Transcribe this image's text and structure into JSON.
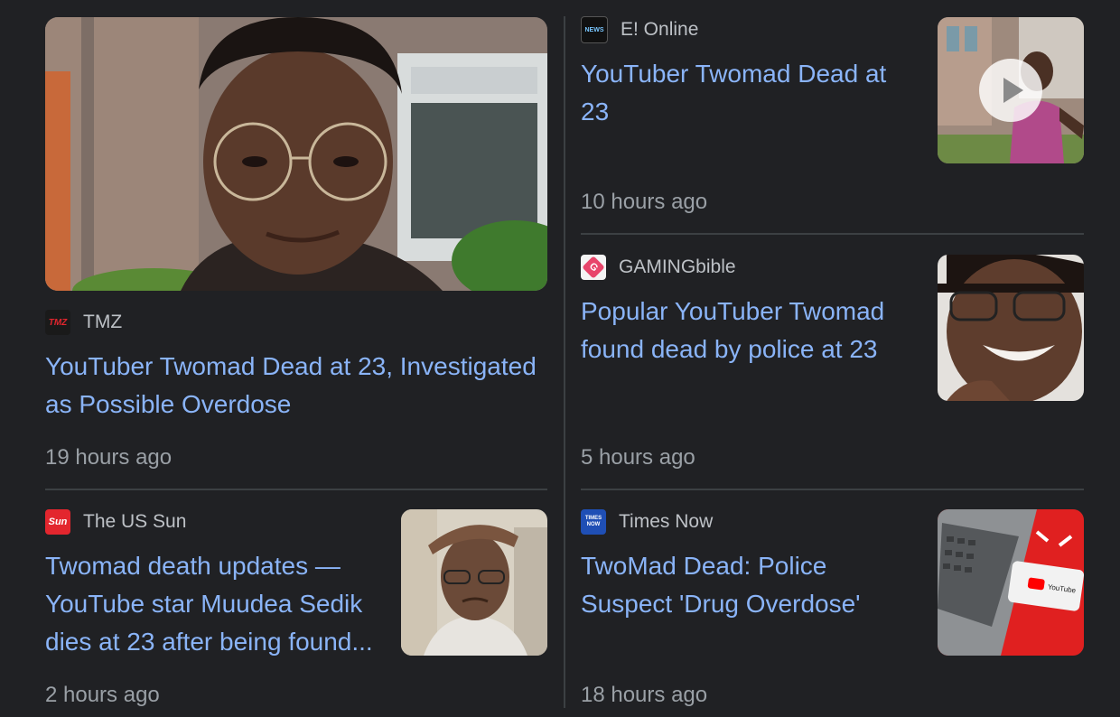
{
  "cards": [
    {
      "source": "TMZ",
      "source_logo": "tmz-logo",
      "headline": "YouTuber Twomad Dead at 23, Investigated as Possible Overdose",
      "time": "19 hours ago",
      "image": "portrait-young-man-glasses-photo"
    },
    {
      "source": "E! Online",
      "source_logo": "e-news-logo",
      "headline": "YouTuber Twomad Dead at 23",
      "time": "10 hours ago",
      "image": "video-thumbnail-young-man",
      "has_video": true
    },
    {
      "source": "GAMINGbible",
      "source_logo": "gamingbible-logo",
      "headline": "Popular YouTuber Twomad found dead by police at 23",
      "time": "5 hours ago",
      "image": "smiling-man-glasses-photo"
    },
    {
      "source": "The US Sun",
      "source_logo": "sun-logo",
      "headline": "Twomad death updates — YouTube star Muudea Sedik dies at 23 after being found...",
      "time": "2 hours ago",
      "image": "man-saluting-selfie-photo"
    },
    {
      "source": "Times Now",
      "source_logo": "times-now-logo",
      "headline": "TwoMad Dead: Police Suspect 'Drug Overdose'",
      "time": "18 hours ago",
      "image": "laptop-phone-youtube-photo"
    }
  ],
  "logo_text": {
    "tmz": "TMZ",
    "enews": "NEWS",
    "sun": "Sun",
    "timesnow": "TIMES NOW",
    "gaming": "G",
    "youtube": "YouTube"
  },
  "colors": {
    "background": "#202124",
    "headline": "#8ab4f8",
    "source": "#bdc1c6",
    "time": "#9aa0a6",
    "divider": "#3c4043"
  }
}
